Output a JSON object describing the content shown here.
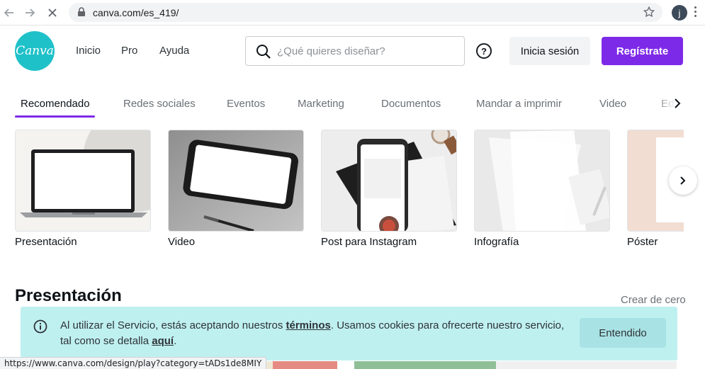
{
  "browser": {
    "url": "canva.com/es_419/",
    "profile_initial": "j",
    "status_url": "https://www.canva.com/design/play?category=tADs1de8MIY"
  },
  "header": {
    "logo_text": "Canva",
    "nav": [
      "Inicio",
      "Pro",
      "Ayuda"
    ],
    "search_placeholder": "¿Qué quieres diseñar?",
    "login_label": "Inicia sesión",
    "signup_label": "Regístrate"
  },
  "tabs": [
    "Recomendado",
    "Redes sociales",
    "Eventos",
    "Marketing",
    "Documentos",
    "Mandar a imprimir",
    "Video",
    "Ed"
  ],
  "cards": [
    "Presentación",
    "Video",
    "Post para Instagram",
    "Infografía",
    "Póster"
  ],
  "section": {
    "title": "Presentación",
    "create_link": "Crear de cero"
  },
  "cookie": {
    "text_before": "Al utilizar el Servicio, estás aceptando nuestros ",
    "terms_link": "términos",
    "text_middle": ". Usamos cookies para ofrecerte nuestro servicio, tal como se detalla ",
    "here_link": "aquí",
    "text_after": ".",
    "button_label": "Entendido"
  },
  "colors": {
    "brand_purple": "#7d2ae8",
    "logo_teal": "#1fc1c9",
    "cookie_bg": "#bff0f0"
  }
}
